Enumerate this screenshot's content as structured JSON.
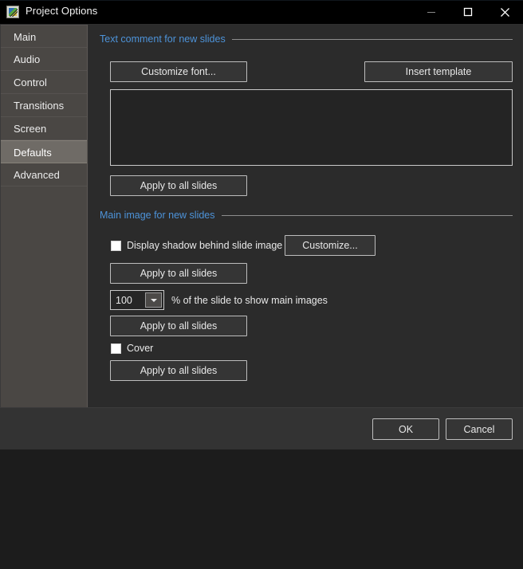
{
  "window": {
    "title": "Project Options",
    "icon": "project-image-icon",
    "controls": {
      "minimize": "minimize-icon",
      "maximize": "maximize-icon",
      "close": "close-icon"
    }
  },
  "sidebar": {
    "items": [
      {
        "label": "Main",
        "selected": false
      },
      {
        "label": "Audio",
        "selected": false
      },
      {
        "label": "Control",
        "selected": false
      },
      {
        "label": "Transitions",
        "selected": false
      },
      {
        "label": "Screen",
        "selected": false
      },
      {
        "label": "Defaults",
        "selected": true
      },
      {
        "label": "Advanced",
        "selected": false
      }
    ]
  },
  "main": {
    "text_comment_group": {
      "title": "Text comment for new slides",
      "customize_font_button": "Customize font...",
      "insert_template_button": "Insert template",
      "comment_textarea_value": "",
      "comment_textarea_placeholder": "",
      "apply_button": "Apply to all slides"
    },
    "main_image_group": {
      "title": "Main image for new slides",
      "shadow_checkbox_label": "Display shadow behind slide image",
      "shadow_checkbox_checked": false,
      "customize_button": "Customize...",
      "apply_shadow_button": "Apply to all slides",
      "percent_value": "100",
      "percent_label": "% of the slide to show main images",
      "apply_percent_button": "Apply to all slides",
      "cover_checkbox_label": "Cover",
      "cover_checkbox_checked": false,
      "apply_cover_button": "Apply to all slides"
    }
  },
  "footer": {
    "ok_button": "OK",
    "cancel_button": "Cancel"
  },
  "colors": {
    "titlebar_bg": "#000000",
    "sidebar_bg": "#4a4744",
    "sidebar_selected_bg": "#6f6b66",
    "panel_bg": "#2b2b2b",
    "footer_bg": "#333333",
    "group_title_accent": "#4d93d9",
    "button_border": "#bdbdbd",
    "text": "#e8e8e8"
  }
}
